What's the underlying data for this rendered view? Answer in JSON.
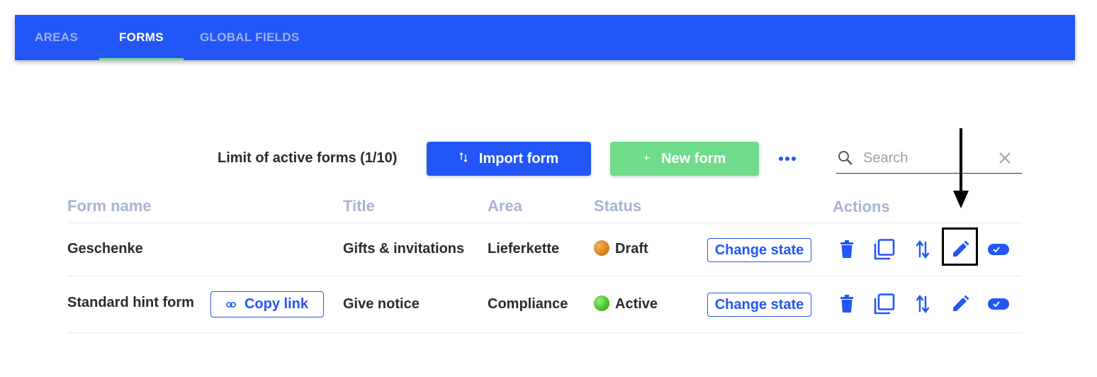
{
  "nav": {
    "tabs": [
      {
        "label": "AREAS",
        "active": false
      },
      {
        "label": "FORMS",
        "active": true
      },
      {
        "label": "GLOBAL FIELDS",
        "active": false
      }
    ]
  },
  "toolbar": {
    "limit_label": "Limit of active forms (1/10)",
    "import_label": "Import form",
    "new_label": "New form",
    "new_icon": "+",
    "more_icon": "more-dots-icon",
    "search_placeholder": "Search"
  },
  "table": {
    "headers": [
      "Form name",
      "Title",
      "Area",
      "Status",
      "Actions"
    ],
    "rows": [
      {
        "form_name": "Geschenke",
        "title": "Gifts & invitations",
        "area": "Lieferkette",
        "status": "Draft",
        "status_color": "#e08a20",
        "change_state_label": "Change state"
      },
      {
        "form_name": "Standard hint form",
        "copy_link_label": "Copy link",
        "title": "Give notice",
        "area": "Compliance",
        "status": "Active",
        "status_color": "#44b82a",
        "change_state_label": "Change state"
      }
    ]
  },
  "colors": {
    "brand_blue": "#2356f6",
    "green": "#6edc8b",
    "header_gray": "#a8b4cf"
  }
}
